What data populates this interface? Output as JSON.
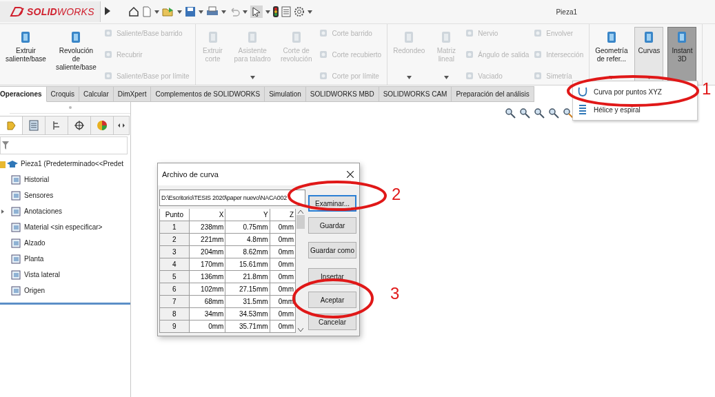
{
  "app": {
    "logo": "**SOLID**WORKS",
    "title": "Pieza1"
  },
  "ribbon": {
    "groups": [
      {
        "items": [
          {
            "kind": "large",
            "label": "Extruir\nsaliente/base",
            "disabled": false,
            "caret": false,
            "open": false,
            "pressed": false
          },
          {
            "kind": "large",
            "label": "Revolución\nde\nsaliente/base",
            "disabled": false,
            "caret": false,
            "open": false,
            "pressed": false
          },
          {
            "kind": "column",
            "items": [
              {
                "label": "Saliente/Base barrido",
                "disabled": true
              },
              {
                "label": "Recubrir",
                "disabled": true
              },
              {
                "label": "Saliente/Base por límite",
                "disabled": true
              }
            ]
          }
        ]
      },
      {
        "items": [
          {
            "kind": "large",
            "label": "Extruir\ncorte",
            "disabled": true,
            "caret": false,
            "open": false,
            "pressed": false
          },
          {
            "kind": "large",
            "label": "Asistente\npara taladro",
            "disabled": true,
            "caret": true,
            "open": false,
            "pressed": false
          },
          {
            "kind": "large",
            "label": "Corte de\nrevolución",
            "disabled": true,
            "caret": false,
            "open": false,
            "pressed": false
          },
          {
            "kind": "column",
            "items": [
              {
                "label": "Corte barrido",
                "disabled": true
              },
              {
                "label": "Corte recubierto",
                "disabled": true
              },
              {
                "label": "Corte por límite",
                "disabled": true
              }
            ]
          }
        ]
      },
      {
        "items": [
          {
            "kind": "large",
            "label": "Redondeo",
            "disabled": true,
            "caret": true,
            "open": false,
            "pressed": false
          },
          {
            "kind": "large",
            "label": "Matriz\nlineal",
            "disabled": true,
            "caret": true,
            "open": false,
            "pressed": false
          },
          {
            "kind": "column",
            "items": [
              {
                "label": "Nervio",
                "disabled": true
              },
              {
                "label": "Ángulo de salida",
                "disabled": true
              },
              {
                "label": "Vaciado",
                "disabled": true
              }
            ]
          },
          {
            "kind": "column",
            "items": [
              {
                "label": "Envolver",
                "disabled": true
              },
              {
                "label": "Intersección",
                "disabled": true
              },
              {
                "label": "Simetría",
                "disabled": true
              }
            ]
          }
        ]
      },
      {
        "items": [
          {
            "kind": "large",
            "label": "Geometría\nde refer...",
            "disabled": false,
            "caret": true,
            "open": false,
            "pressed": false
          },
          {
            "kind": "large",
            "label": "Curvas",
            "disabled": false,
            "caret": true,
            "open": true,
            "pressed": false
          },
          {
            "kind": "large",
            "label": "Instant\n3D",
            "disabled": false,
            "caret": false,
            "open": false,
            "pressed": true
          }
        ]
      }
    ]
  },
  "tabs": [
    {
      "label": "Operaciones",
      "selected": true
    },
    {
      "label": "Croquis",
      "selected": false
    },
    {
      "label": "Calcular",
      "selected": false
    },
    {
      "label": "DimXpert",
      "selected": false
    },
    {
      "label": "Complementos de SOLIDWORKS",
      "selected": false
    },
    {
      "label": "Simulation",
      "selected": false
    },
    {
      "label": "SOLIDWORKS MBD",
      "selected": false
    },
    {
      "label": "SOLIDWORKS CAM",
      "selected": false
    },
    {
      "label": "Preparación del análisis",
      "selected": false
    }
  ],
  "curves_menu": {
    "items": [
      {
        "label": "Curva por puntos XYZ"
      },
      {
        "label": "Hélice y espiral"
      }
    ]
  },
  "panel_tabs": [
    {
      "selected": true
    },
    {
      "selected": false
    },
    {
      "selected": false
    },
    {
      "selected": false
    },
    {
      "selected": false
    }
  ],
  "feature_tree": {
    "root": "Pieza1  (Predeterminado<<Predet",
    "children": [
      {
        "label": "Historial",
        "expandable": false
      },
      {
        "label": "Sensores",
        "expandable": false
      },
      {
        "label": "Anotaciones",
        "expandable": true
      },
      {
        "label": "Material <sin especificar>",
        "expandable": false
      },
      {
        "label": "Alzado",
        "expandable": false
      },
      {
        "label": "Planta",
        "expandable": false
      },
      {
        "label": "Vista lateral",
        "expandable": false
      },
      {
        "label": "Origen",
        "expandable": false
      }
    ]
  },
  "dialog": {
    "title": "Archivo de curva",
    "path": "D:\\Escritorio\\TESIS 2020\\paper nuevo\\NACA002",
    "columns": [
      "Punto",
      "X",
      "Y",
      "Z"
    ],
    "rows": [
      [
        "1",
        "238mm",
        "0.75mm",
        "0mm"
      ],
      [
        "2",
        "221mm",
        "4.8mm",
        "0mm"
      ],
      [
        "3",
        "204mm",
        "8.62mm",
        "0mm"
      ],
      [
        "4",
        "170mm",
        "15.61mm",
        "0mm"
      ],
      [
        "5",
        "136mm",
        "21.8mm",
        "0mm"
      ],
      [
        "6",
        "102mm",
        "27.15mm",
        "0mm"
      ],
      [
        "7",
        "68mm",
        "31.5mm",
        "0mm"
      ],
      [
        "8",
        "34mm",
        "34.53mm",
        "0mm"
      ],
      [
        "9",
        "0mm",
        "35.71mm",
        "0mm"
      ]
    ],
    "buttons": [
      {
        "label": "Examinar...",
        "focused": true
      },
      {
        "label": "Guardar",
        "focused": false
      },
      {
        "label": "Guardar como",
        "focused": false
      },
      {
        "label": "Insertar",
        "focused": false
      },
      {
        "label": "Aceptar",
        "focused": false
      },
      {
        "label": "Cancelar",
        "focused": false
      }
    ]
  },
  "annotations": [
    {
      "label": "1"
    },
    {
      "label": "2"
    },
    {
      "label": "3"
    }
  ]
}
